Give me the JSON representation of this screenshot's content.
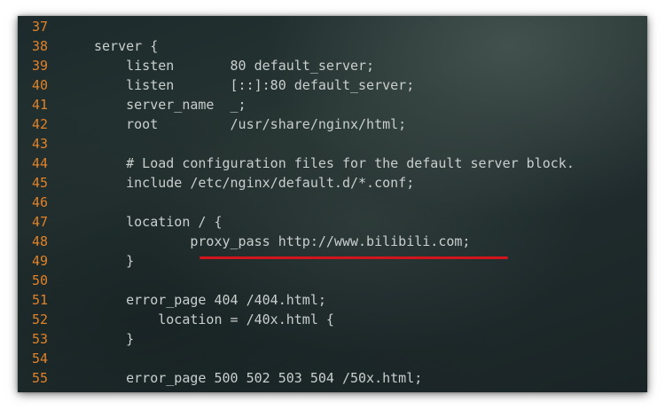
{
  "editor": {
    "lines": [
      {
        "num": "37",
        "text": ""
      },
      {
        "num": "38",
        "text": "server {"
      },
      {
        "num": "39",
        "text": "    listen       80 default_server;"
      },
      {
        "num": "40",
        "text": "    listen       [::]:80 default_server;"
      },
      {
        "num": "41",
        "text": "    server_name  _;"
      },
      {
        "num": "42",
        "text": "    root         /usr/share/nginx/html;"
      },
      {
        "num": "43",
        "text": ""
      },
      {
        "num": "44",
        "text": "    # Load configuration files for the default server block."
      },
      {
        "num": "45",
        "text": "    include /etc/nginx/default.d/*.conf;"
      },
      {
        "num": "46",
        "text": ""
      },
      {
        "num": "47",
        "text": "    location / {"
      },
      {
        "num": "48",
        "text": "            proxy_pass http://www.bilibili.com;"
      },
      {
        "num": "49",
        "text": "    }"
      },
      {
        "num": "50",
        "text": ""
      },
      {
        "num": "51",
        "text": "    error_page 404 /404.html;"
      },
      {
        "num": "52",
        "text": "        location = /40x.html {"
      },
      {
        "num": "53",
        "text": "    }"
      },
      {
        "num": "54",
        "text": ""
      },
      {
        "num": "55",
        "text": "    error_page 500 502 503 504 /50x.html;"
      }
    ]
  },
  "colors": {
    "line_number": "#e0822a",
    "code_text": "#c9cfcd",
    "underline": "#d2141c",
    "background": "#1f2b2c"
  }
}
